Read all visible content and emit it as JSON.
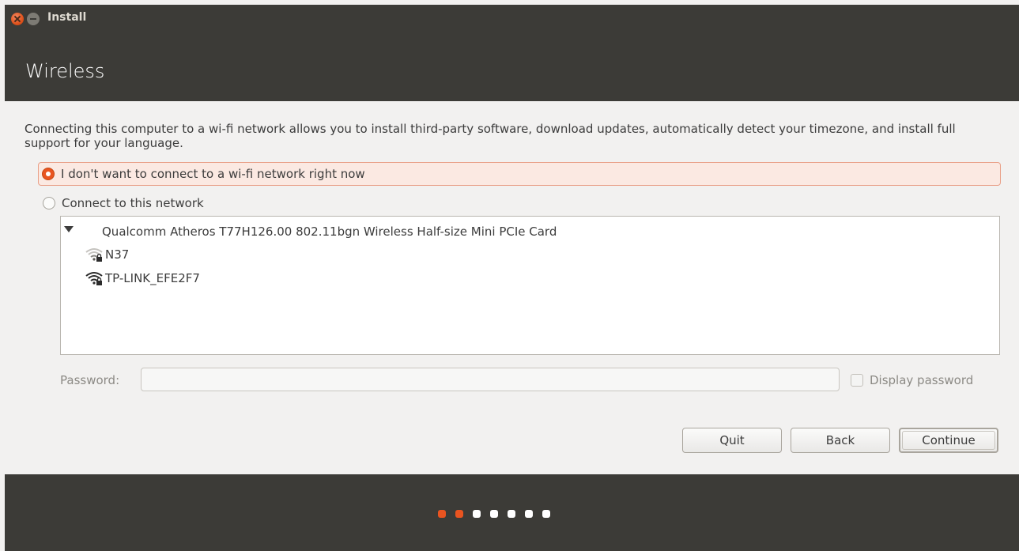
{
  "window": {
    "title": "Install"
  },
  "header": {
    "page_title": "Wireless"
  },
  "description": "Connecting this computer to a wi-fi network allows you to install third-party software, download updates, automatically detect your timezone, and install full support for your language.",
  "options": {
    "no_connect": "I don't want to connect to a wi-fi network right now",
    "connect": "Connect to this network",
    "selected": "no_connect"
  },
  "network_list": {
    "adapter": "Qualcomm Atheros T77H126.00 802.11bgn Wireless Half-size Mini PCIe Card",
    "networks": [
      {
        "ssid": "N37",
        "icon": "wifi-weak-locked-icon"
      },
      {
        "ssid": "TP-LINK_EFE2F7",
        "icon": "wifi-strong-locked-icon"
      }
    ]
  },
  "password": {
    "label": "Password:",
    "value": "",
    "display_label": "Display password",
    "display_checked": false
  },
  "buttons": {
    "quit": "Quit",
    "back": "Back",
    "continue": "Continue"
  },
  "progress": {
    "total_steps": 7,
    "current_step": 2
  },
  "colors": {
    "accent": "#e95420",
    "dark": "#3c3b37",
    "background": "#f2f1f0"
  }
}
